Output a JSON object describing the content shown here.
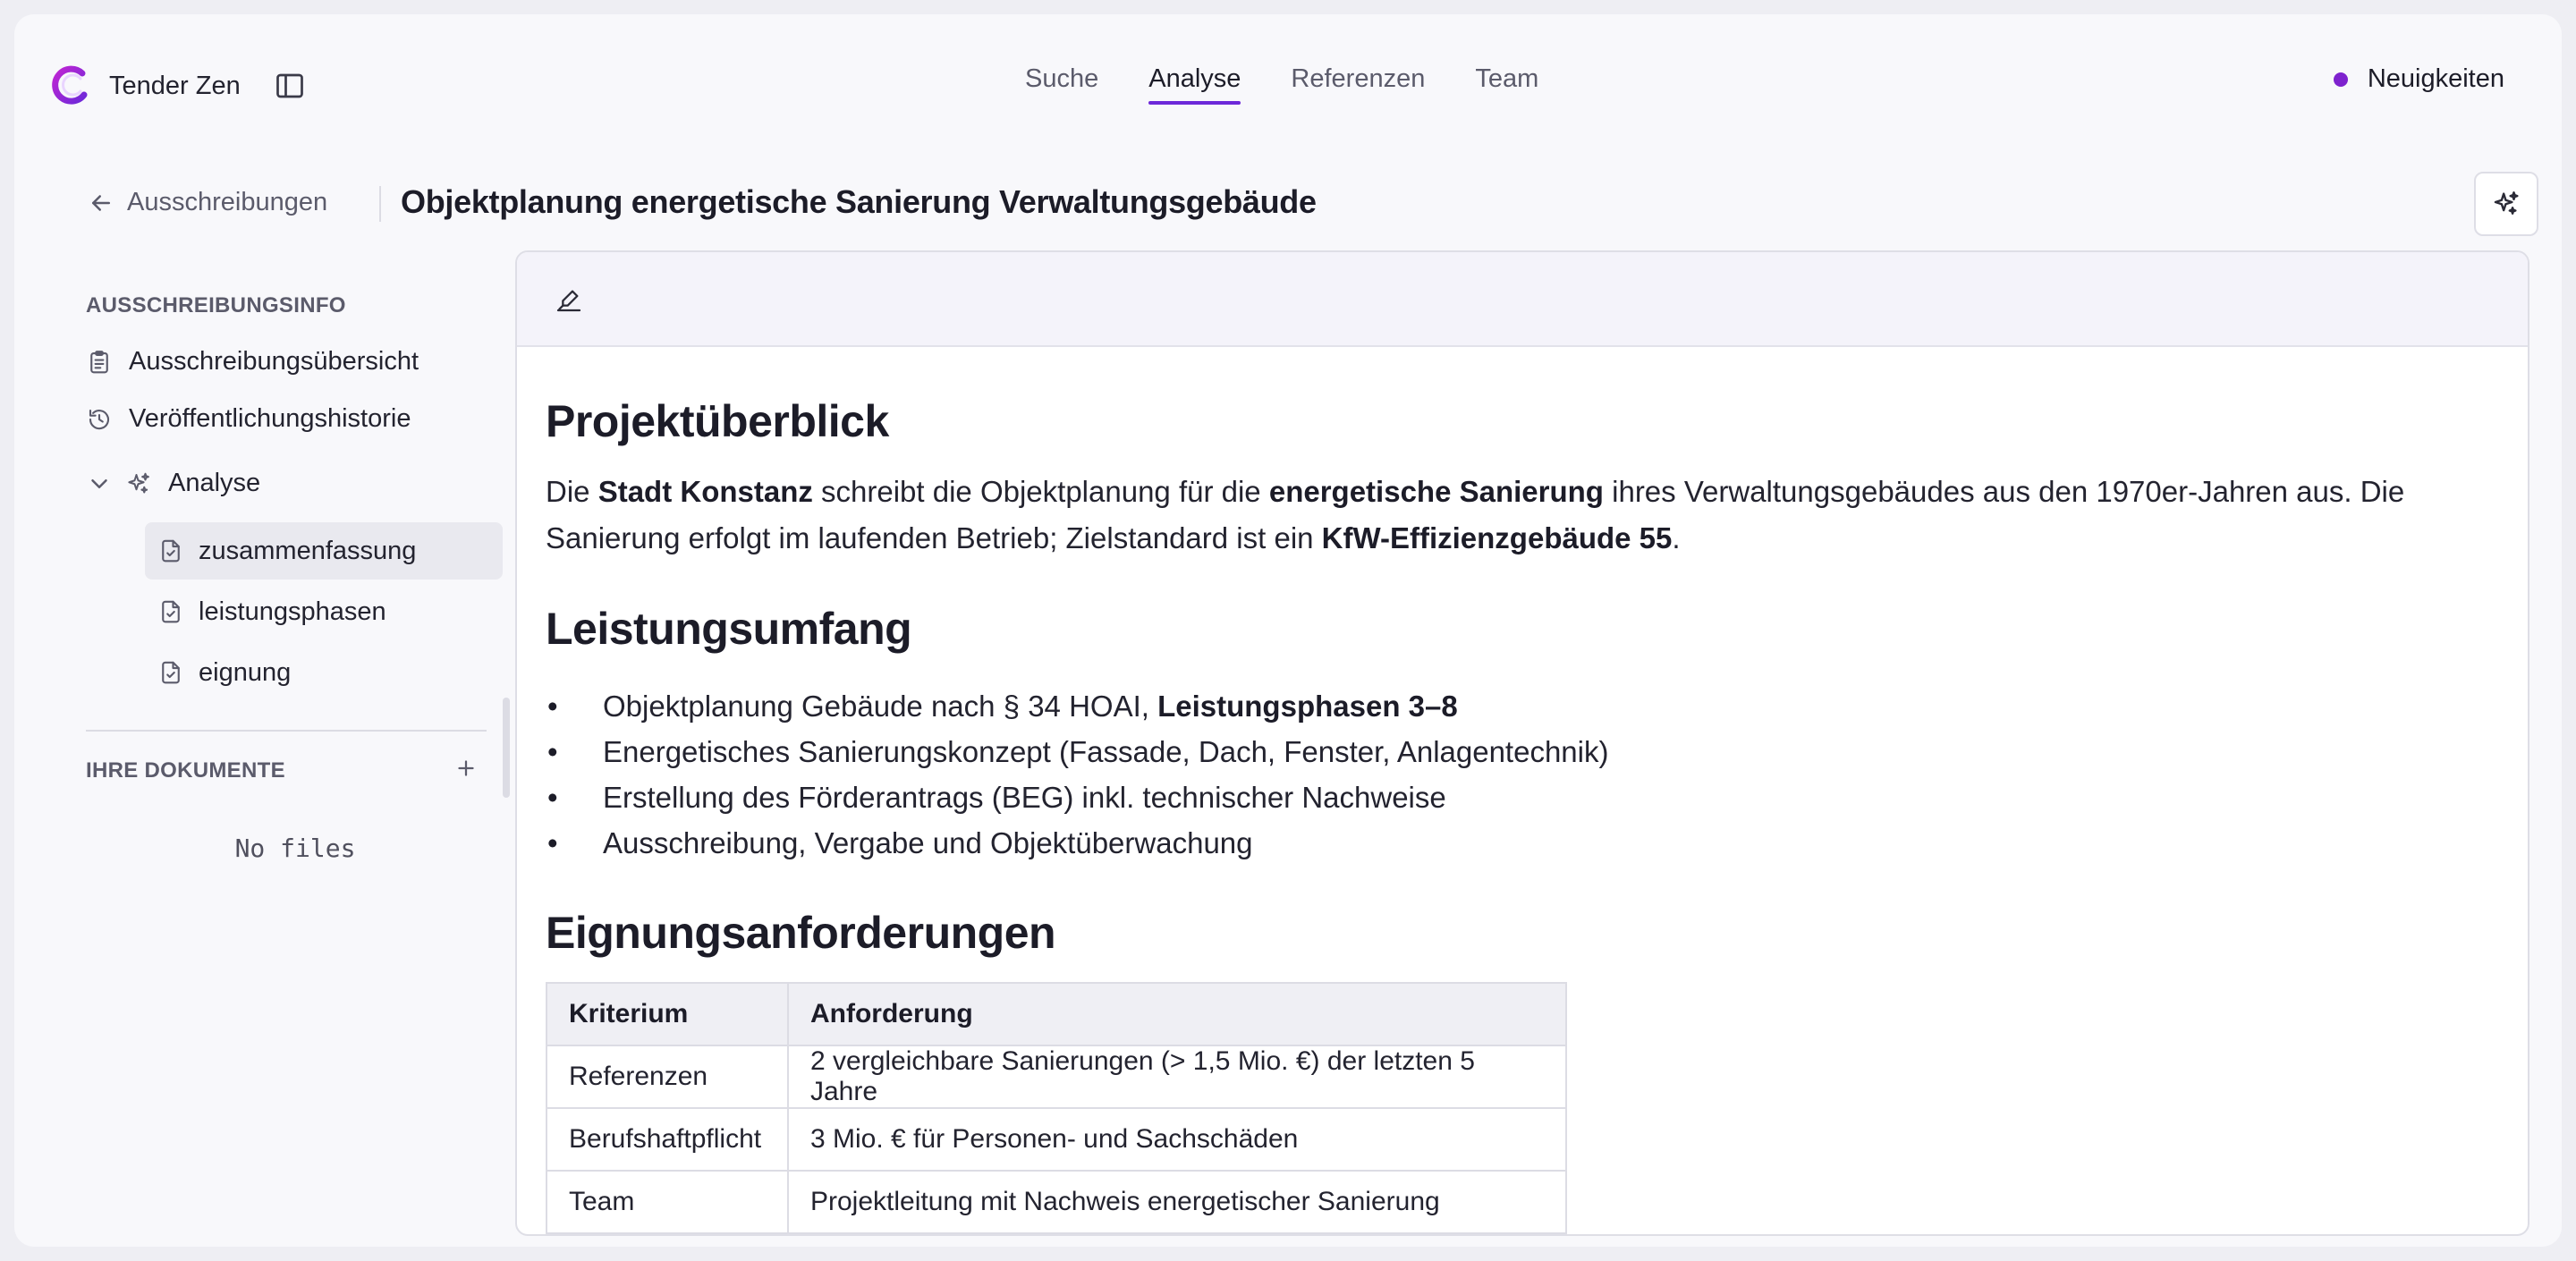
{
  "app": {
    "name": "Tender Zen"
  },
  "nav": {
    "tabs": [
      {
        "label": "Suche",
        "active": false
      },
      {
        "label": "Analyse",
        "active": true
      },
      {
        "label": "Referenzen",
        "active": false
      },
      {
        "label": "Team",
        "active": false
      }
    ],
    "news_label": "Neuigkeiten"
  },
  "breadcrumb": {
    "back_label": "Ausschreibungen",
    "title": "Objektplanung energetische Sanierung Verwaltungsgebäude"
  },
  "sidebar": {
    "info_title": "AUSSCHREIBUNGSINFO",
    "items": [
      {
        "label": "Ausschreibungsübersicht",
        "icon": "clipboard-list-icon"
      },
      {
        "label": "Veröffentlichungshistorie",
        "icon": "history-icon"
      }
    ],
    "analysis": {
      "label": "Analyse",
      "expanded": true,
      "children": [
        {
          "label": "zusammenfassung",
          "active": true
        },
        {
          "label": "leistungsphasen",
          "active": false
        },
        {
          "label": "eignung",
          "active": false
        }
      ]
    },
    "docs_title": "IHRE DOKUMENTE",
    "no_files": "No files"
  },
  "document": {
    "overview": {
      "heading": "Projektüberblick",
      "p1_a": "Die ",
      "p1_b": "Stadt Konstanz",
      "p1_c": " schreibt die Objektplanung für die ",
      "p1_d": "energetische Sanierung",
      "p1_e": " ihres Verwaltungsgebäudes aus den 1970er-Jahren aus. Die Sanierung erfolgt im laufenden Betrieb; Zielstandard ist ein ",
      "p1_f": "KfW-Effizienzgebäude 55",
      "p1_g": "."
    },
    "scope": {
      "heading": "Leistungsumfang",
      "item1_a": "Objektplanung Gebäude nach § 34 HOAI, ",
      "item1_b": "Leistungsphasen 3–8",
      "items": [
        "Energetisches Sanierungskonzept (Fassade, Dach, Fenster, Anlagentechnik)",
        "Erstellung des Förderantrags (BEG) inkl. technischer Nachweise",
        "Ausschreibung, Vergabe und Objektüberwachung"
      ]
    },
    "requirements": {
      "heading": "Eignungsanforderungen",
      "columns": [
        "Kriterium",
        "Anforderung"
      ],
      "rows": [
        [
          "Referenzen",
          "2 vergleichbare Sanierungen (> 1,5 Mio. €) der letzten 5 Jahre"
        ],
        [
          "Berufshaftpflicht",
          "3 Mio. € für Personen- und Sachschäden"
        ],
        [
          "Team",
          "Projektleitung mit Nachweis energetischer Sanierung"
        ]
      ]
    }
  },
  "colors": {
    "accent": "#6d28d9",
    "news_dot": "#7e22ce",
    "toolbar_bg": "#f4f3fa"
  }
}
